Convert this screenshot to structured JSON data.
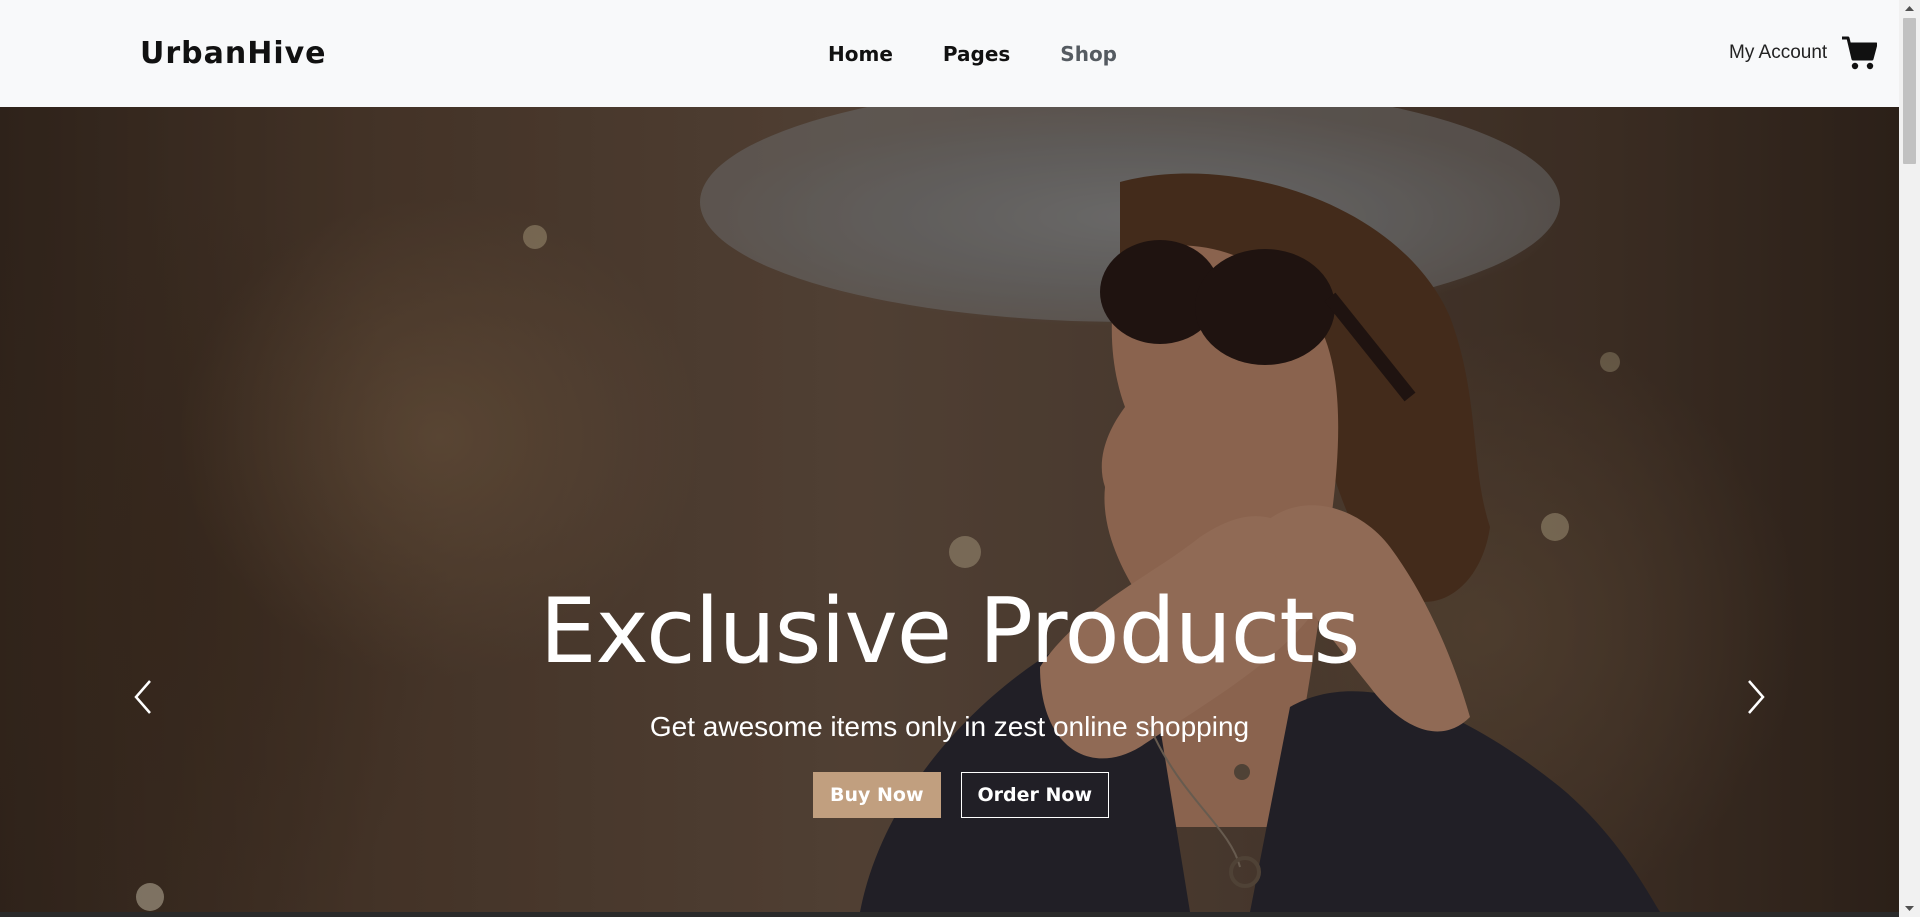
{
  "header": {
    "brand": "UrbanHive",
    "nav": [
      {
        "label": "Home"
      },
      {
        "label": "Pages"
      },
      {
        "label": "Shop"
      }
    ],
    "account_label": "My Account",
    "cart_icon": "cart-icon"
  },
  "hero": {
    "title": "Exclusive Products",
    "subtitle": "Get awesome items only in zest online shopping",
    "buttons": {
      "primary": "Buy Now",
      "secondary": "Order Now"
    },
    "prev_icon": "chevron-left-icon",
    "next_icon": "chevron-right-icon"
  },
  "colors": {
    "accent": "#c19f7f",
    "header_bg": "#f8f9fa",
    "text_dark": "#111111"
  }
}
